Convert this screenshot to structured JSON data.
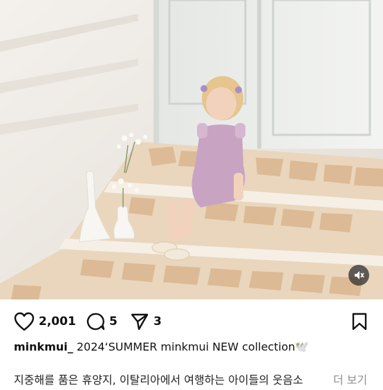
{
  "post": {
    "photo_alt_icon": "photo-of-child-on-stone-steps",
    "likes": "2,001",
    "comments": "5",
    "shares": "3",
    "username": "minkmui_",
    "caption_text": "2024‘SUMMER minkmui NEW collection🕊️",
    "caption_line2": "지중해를 품은 휴양지, 이탈리아에서 여행하는 아이들의 웃음소",
    "more_label": "더 보기"
  },
  "colors": {
    "icon": "#111111",
    "muted": "#8e8e8e"
  }
}
